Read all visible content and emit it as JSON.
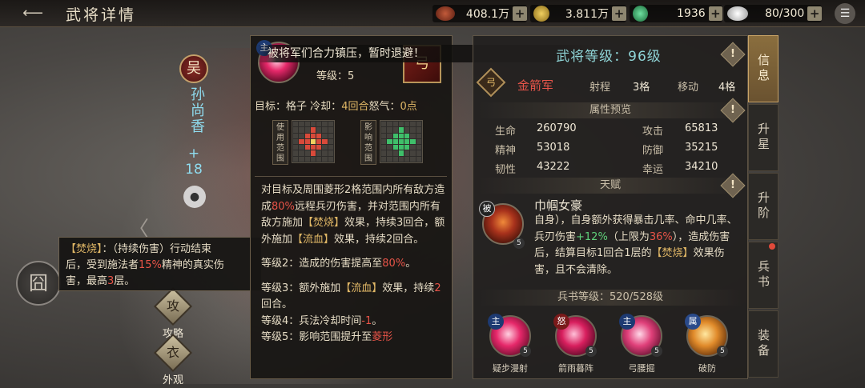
{
  "header": {
    "back_symbol": "⟵",
    "title": "武将详情",
    "resources": [
      {
        "icon": "copper-coin-icon",
        "value": "408.1万",
        "plus": "+"
      },
      {
        "icon": "gold-coin-icon",
        "value": "3.811万",
        "plus": "+"
      },
      {
        "icon": "jade-icon",
        "value": "1936",
        "plus": "+"
      },
      {
        "icon": "silver-icon",
        "value": "80/300",
        "plus": "+"
      }
    ],
    "menu_symbol": "☰"
  },
  "hero": {
    "faction": "吴",
    "name": "孙尚香",
    "plus": "+\n18",
    "lock_symbol": "🔒"
  },
  "side_buttons": [
    {
      "label": "攻略",
      "glyph": "攻"
    },
    {
      "label": "外观",
      "glyph": "衣"
    }
  ],
  "codex_glyph": "囧",
  "status_tip": {
    "line1_tag": "【焚烧】",
    "line1_rest": "：（持续伤害）行动结束",
    "line2a": "后，受到施法者",
    "line2_pct": "15%",
    "line2b": "精神的真实伤",
    "line3a": "害，最高",
    "line3_num": "3",
    "line3b": "层。"
  },
  "skill": {
    "banner": "被将军们合力镇压，暂时退避！",
    "main_tag": "主",
    "level": "等级：5",
    "card_glyph": "弓",
    "target_k": "目标：",
    "target_v": "格子",
    "cd_k": "冷却：",
    "cd_v": "4回合",
    "rage_k": "怒气：",
    "rage_v": "0点",
    "use_range_label": "使用范围",
    "effect_range_label": "影响范围",
    "desc": {
      "p1a": "对目标及周围菱形2格范围内所有敌方造成",
      "p1_pct": "80%",
      "p1b": "远程兵刃伤害，并对范围内所有敌方施加",
      "p1_burn": "【焚烧】",
      "p1c": "效果，持续3回合，额外施加",
      "p1_bleed": "【流血】",
      "p1d": "效果，持续2回合。",
      "l2a": "等级2：造成的伤害提高至",
      "l2_pct": "80%",
      "l2b": "。",
      "l3a": "等级3：额外施加",
      "l3_bleed": "【流血】",
      "l3b": "效果，持续",
      "l3_num": "2",
      "l3c": "回合。",
      "l4a": "等级4：兵法冷却时间",
      "l4_num": "-1",
      "l4b": "。",
      "l5a": "等级5：影响范围提升至",
      "l5_v": "菱形"
    }
  },
  "info": {
    "level_title": "武将等级：96级",
    "excl": "!",
    "unit_glyph": "弓",
    "unit_name": "金箭军",
    "range_k": "射程",
    "range_v": "3格",
    "move_k": "移动",
    "move_v": "4格",
    "attr_title": "属性预览",
    "stats": [
      {
        "k": "生命",
        "v": "260790"
      },
      {
        "k": "攻击",
        "v": "65813"
      },
      {
        "k": "精神",
        "v": "53018"
      },
      {
        "k": "防御",
        "v": "35215"
      },
      {
        "k": "韧性",
        "v": "43222"
      },
      {
        "k": "幸运",
        "v": "34210"
      }
    ],
    "talent_title": "天赋",
    "talent_tag": "被",
    "talent_lvl": "5",
    "talent_name": "巾帼女豪",
    "talent": {
      "a": "自身），自身额外获得暴击几率、命中几率、兵刃伤害",
      "pct1": "+12%",
      "b": "（上限为",
      "pct2": "36%",
      "c": "），造成伤害后，结算目标1回合1层的",
      "burn": "【焚烧】",
      "d": "效果伤害，且不会清除。"
    },
    "book_title": "兵书等级：520/528级",
    "book_skills": [
      {
        "tag": "主",
        "lv": "5",
        "name": "疑步漫射"
      },
      {
        "tag": "怒",
        "lv": "5",
        "name": "箭雨暮阵"
      },
      {
        "tag": "主",
        "lv": "5",
        "name": "弓腰掘"
      },
      {
        "tag": "属",
        "lv": "5",
        "name": "破防"
      }
    ]
  },
  "tabs": [
    {
      "label": "信息",
      "active": true
    },
    {
      "label": "升星",
      "active": false
    },
    {
      "label": "升阶",
      "active": false
    },
    {
      "label": "兵书",
      "active": false
    },
    {
      "label": "装备",
      "active": false
    }
  ]
}
